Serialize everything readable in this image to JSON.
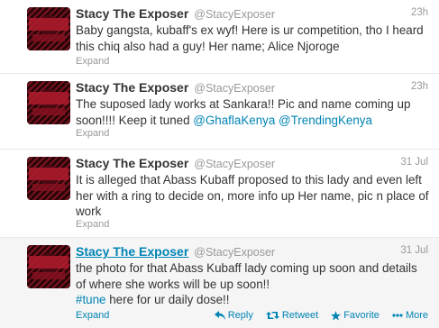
{
  "tweets": [
    {
      "name": "Stacy The Exposer",
      "handle": "@StacyExposer",
      "time": "23h",
      "text": "Baby gangsta, kubaff's ex wyf! Here is ur competition, tho I heard this chiq also had a guy! Her name; Alice Njoroge",
      "expand": "Expand"
    },
    {
      "name": "Stacy The Exposer",
      "handle": "@StacyExposer",
      "time": "23h",
      "text_prefix": "The suposed lady works at Sankara!! Pic and name coming up soon!!!! Keep it tuned ",
      "mention_1": "@GhaflaKenya",
      "mention_2": "@TrendingKenya",
      "expand": "Expand"
    },
    {
      "name": "Stacy The Exposer",
      "handle": "@StacyExposer",
      "time": "31 Jul",
      "text": "It is alleged that Abass Kubaff proposed to this lady and even left her with a ring to decide on, more info up Her name, pic n place of work",
      "expand": "Expand"
    },
    {
      "name": "Stacy The Exposer",
      "handle": "@StacyExposer",
      "time": "31 Jul",
      "text": "the photo for that Abass Kubaff lady coming up soon and details of where she works will be up soon!!",
      "hashtag": "#tune",
      "text_suffix": " here for ur daily dose!!",
      "expand": "Expand",
      "actions": {
        "reply": "Reply",
        "retweet": "Retweet",
        "favorite": "Favorite",
        "more": "More"
      }
    }
  ],
  "colors": {
    "link": "#0084b4",
    "muted": "#999999",
    "text": "#333333",
    "hover_bg": "#f5f5f5"
  }
}
